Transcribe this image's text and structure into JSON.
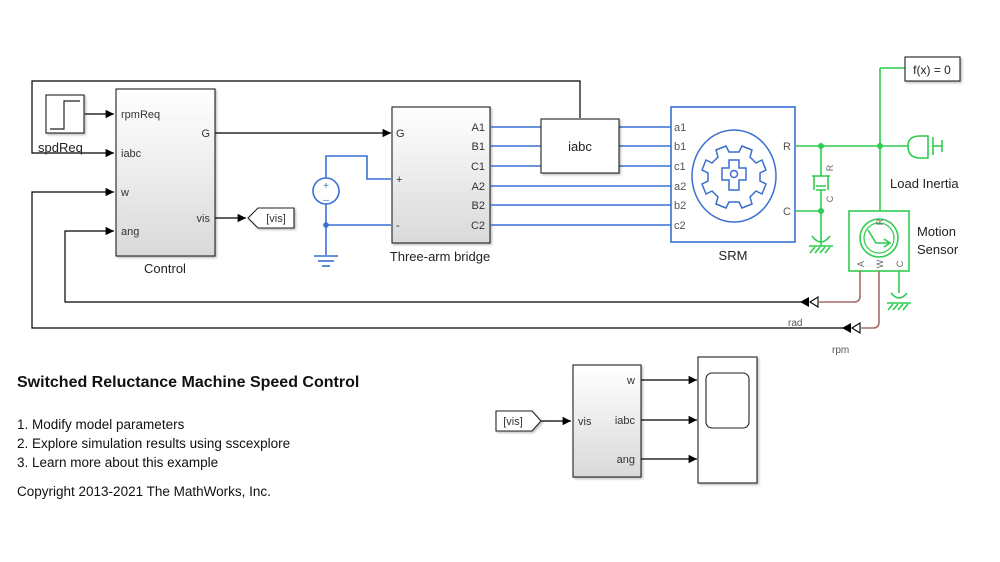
{
  "model_title": "Switched Reluctance Machine Speed Control",
  "links": [
    "1. Modify model parameters",
    "2. Explore simulation results using sscexplore",
    "3. Learn more about this example"
  ],
  "copyright": "Copyright 2013-2021 The MathWorks, Inc.",
  "blocks": {
    "step": {
      "label": "spdReq"
    },
    "control": {
      "label": "Control",
      "inputs": [
        "rpmReq",
        "iabc",
        "w",
        "ang"
      ],
      "outputs": [
        "G",
        "vis"
      ]
    },
    "goto_vis": {
      "label": "[vis]"
    },
    "bridge": {
      "label": "Three-arm bridge",
      "inputs": [
        "G",
        "+",
        "-"
      ],
      "outputs": [
        "A1",
        "B1",
        "C1",
        "A2",
        "B2",
        "C2"
      ]
    },
    "current_sensor": {
      "label": "iabc"
    },
    "srm": {
      "label": "SRM",
      "inputs": [
        "a1",
        "b1",
        "c1",
        "a2",
        "b2",
        "c2"
      ],
      "outputs": [
        "R",
        "C"
      ]
    },
    "damper": {
      "port_top": "R",
      "port_bottom": "C"
    },
    "solver": {
      "label": "f(x) = 0"
    },
    "inertia": {
      "label": "Load Inertia"
    },
    "motion_sensor": {
      "label_line1": "Motion",
      "label_line2": "Sensor",
      "ports": [
        "R",
        "A",
        "W",
        "C"
      ]
    },
    "signal_rad": {
      "label": "rad"
    },
    "signal_rpm": {
      "label": "rpm"
    },
    "from_vis": {
      "label": "[vis]"
    },
    "vis_bus": {
      "input": "vis",
      "outputs": [
        "w",
        "iabc",
        "ang"
      ]
    }
  },
  "colors": {
    "electrical": "#3a6fd0",
    "mechanical": "#2ecc4f",
    "ps_signal": "#a86a6a",
    "signal": "#000000"
  }
}
